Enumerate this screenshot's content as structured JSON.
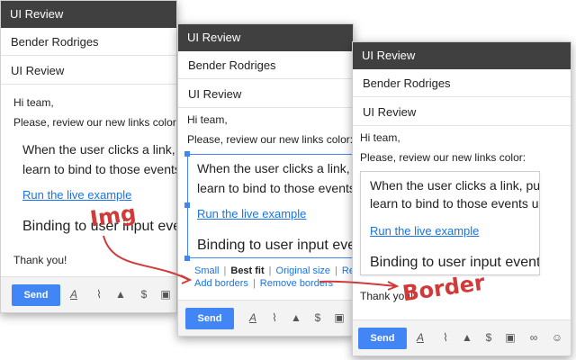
{
  "windows": [
    {
      "title": "UI Review",
      "from": "Bender Rodriges",
      "subject": "UI Review",
      "greeting": "Hi team,",
      "request": "Please, review our new links color:",
      "quote_line1": "When the user clicks a link, pushes a",
      "quote_line2": "learn to bind to those events using th",
      "link_text": "Run the live example",
      "heading": "Binding to user input events",
      "thanks": "Thank you!",
      "send_label": "Send"
    },
    {
      "title": "UI Review",
      "from": "Bender Rodriges",
      "subject": "UI Review",
      "greeting": "Hi team,",
      "request": "Please, review our new links color:",
      "quote_line1": "When the user clicks a link, pushes a",
      "quote_line2": "learn to bind to those events using th",
      "link_text": "Run the live example",
      "heading": "Binding to user input events",
      "image_toolbar": {
        "small": "Small",
        "best_fit": "Best fit",
        "original": "Original size",
        "remove": "Remove",
        "add_borders": "Add borders",
        "remove_borders": "Remove borders"
      },
      "send_label": "Send"
    },
    {
      "title": "UI Review",
      "from": "Bender Rodriges",
      "subject": "UI Review",
      "greeting": "Hi team,",
      "request": "Please, review our new links color:",
      "quote_line1": "When the user clicks a link, pushes a",
      "quote_line2": "learn to bind to those events using th",
      "link_text": "Run the live example",
      "heading": "Binding to user input events",
      "thanks": "Thank you!",
      "send_label": "Send"
    }
  ],
  "annotations": {
    "img": "Img",
    "border": "Border"
  },
  "colors": {
    "accent": "#4285f4",
    "link": "#1a73e8",
    "annotation": "#d23a3a",
    "titlebar": "#404040"
  },
  "icons": [
    "format-text-icon",
    "attach-icon",
    "drive-icon",
    "dollar-icon",
    "photo-icon",
    "link-icon",
    "emoji-icon"
  ]
}
